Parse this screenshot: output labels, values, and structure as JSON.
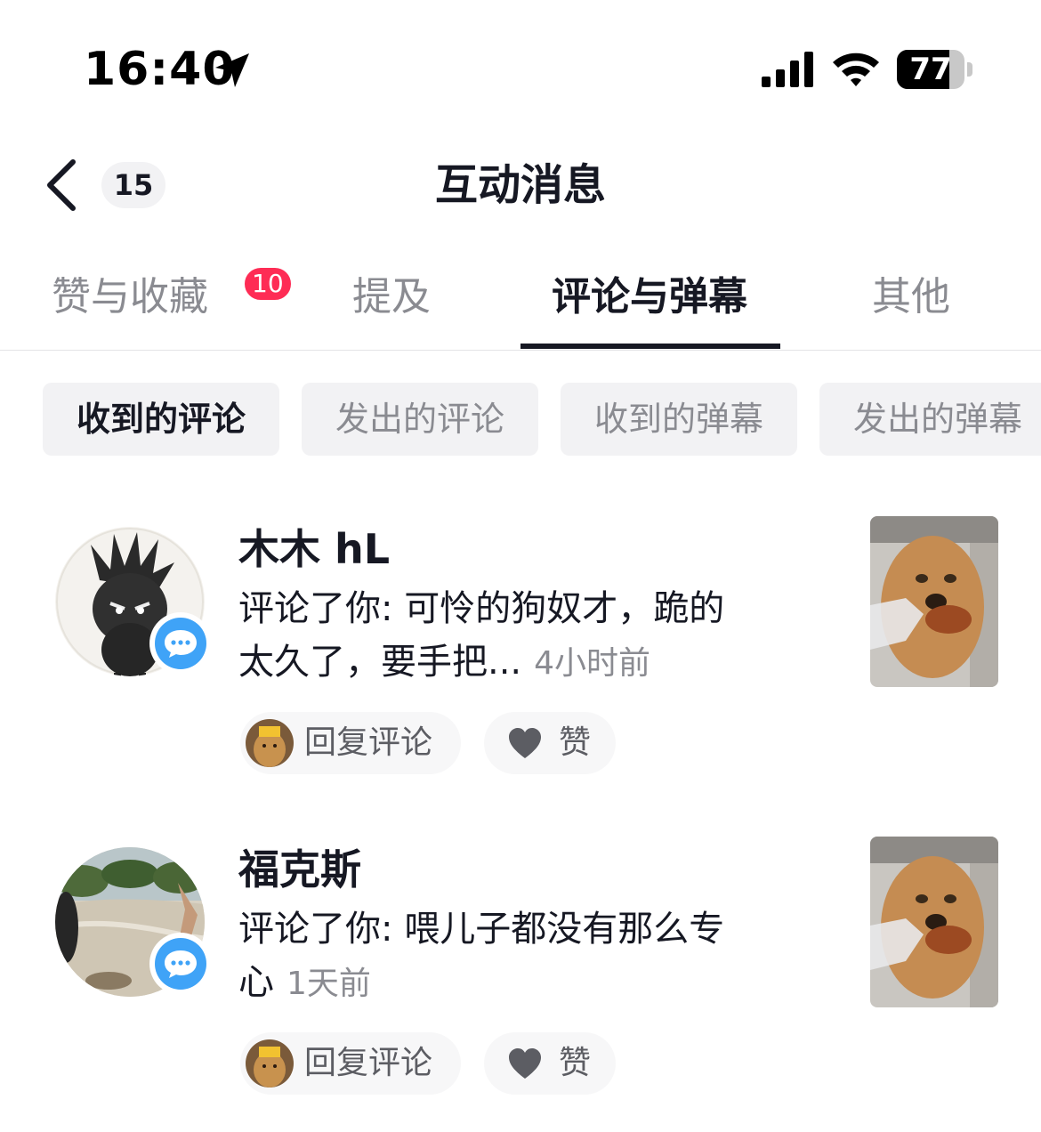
{
  "status_bar": {
    "time": "16:40",
    "battery": "77",
    "battery_level": 0.77
  },
  "header": {
    "back_count": "15",
    "title": "互动消息"
  },
  "tabs": [
    {
      "label": "赞与收藏",
      "badge": "10"
    },
    {
      "label": "提及"
    },
    {
      "label": "评论与弹幕",
      "active": true
    },
    {
      "label": "其他"
    }
  ],
  "filters": [
    {
      "label": "收到的评论",
      "active": true
    },
    {
      "label": "发出的评论"
    },
    {
      "label": "收到的弹幕"
    },
    {
      "label": "发出的弹幕"
    }
  ],
  "comments": [
    {
      "username": "木木 hL",
      "text": "评论了你: 可怜的狗奴才，跪的太久了，要手把...",
      "time": "4小时前",
      "reply_label": "回复评论",
      "like_label": "赞"
    },
    {
      "username": "福克斯",
      "text": "评论了你: 喂儿子都没有那么专心",
      "time": "1天前",
      "reply_label": "回复评论",
      "like_label": "赞"
    }
  ],
  "colors": {
    "accent": "#fe2c55",
    "comment_badge": "#3fa3f7",
    "text_primary": "#161823",
    "text_secondary": "#8a8b91"
  }
}
